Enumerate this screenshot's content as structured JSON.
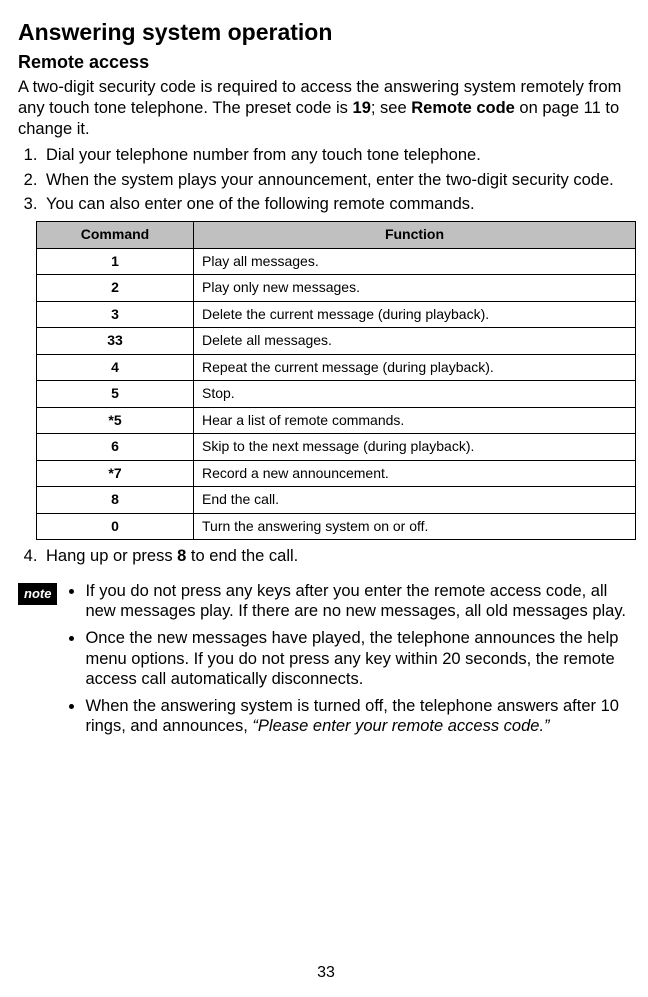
{
  "h1": "Answering system operation",
  "h2": "Remote access",
  "intro_parts": {
    "p1": "A two-digit security code is required to access the answering system remotely from any touch tone telephone. The preset code is ",
    "code": "19",
    "p2": "; see ",
    "ref": "Remote code",
    "p3": " on page 11 to change it."
  },
  "steps": {
    "s1": "Dial your telephone number from any touch tone telephone.",
    "s2": "When the system plays your announcement, enter the two-digit security code.",
    "s3": "You can also enter one of the following remote commands."
  },
  "table_headers": {
    "col1": "Command",
    "col2": "Function"
  },
  "table_rows": [
    {
      "cmd": "1",
      "func": "Play all messages."
    },
    {
      "cmd": "2",
      "func": "Play only new messages."
    },
    {
      "cmd": "3",
      "func": "Delete the current message (during playback)."
    },
    {
      "cmd": "33",
      "func": "Delete all messages."
    },
    {
      "cmd": "4",
      "func": "Repeat the current message (during playback)."
    },
    {
      "cmd": "5",
      "func": "Stop."
    },
    {
      "cmd": "*5",
      "func": "Hear a list of remote commands."
    },
    {
      "cmd": "6",
      "func": "Skip to the next message (during playback)."
    },
    {
      "cmd": "*7",
      "func": "Record a new announcement."
    },
    {
      "cmd": "8",
      "func": "End the call."
    },
    {
      "cmd": "0",
      "func": "Turn the answering system on or off."
    }
  ],
  "step4_parts": {
    "p1": "Hang up or press ",
    "key": "8",
    "p2": " to end the call."
  },
  "note_label": "note",
  "notes": {
    "n1": "If you do not press any keys after you enter the remote access code, all new messages play. If there are no new messages, all old messages play.",
    "n2": "Once the new messages have played, the telephone announces the help menu options. If you do not press any key within 20 seconds, the remote access call automatically disconnects.",
    "n3_p1": "When the answering system is turned off, the telephone answers after 10 rings, and announces, ",
    "n3_quote": "“Please enter your remote access code.”"
  },
  "page_number": "33"
}
